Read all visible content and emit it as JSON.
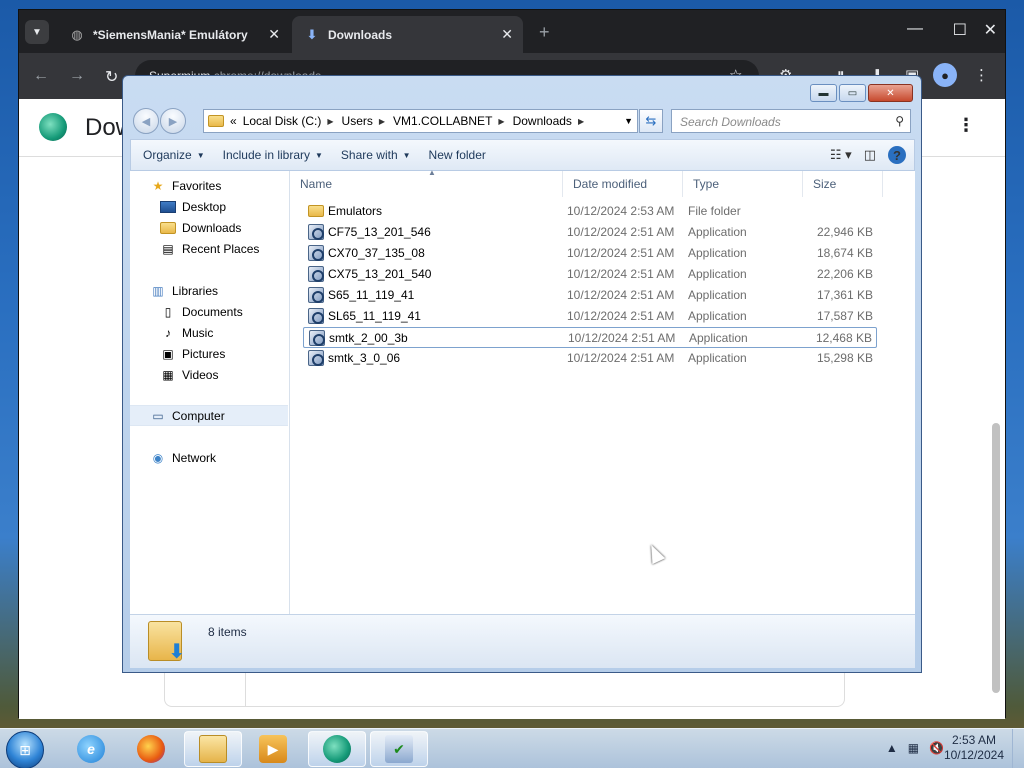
{
  "browser": {
    "tabs": [
      {
        "title": "*SiemensMania* Emulátory",
        "icon": "globe-icon"
      },
      {
        "title": "Downloads",
        "icon": "download-icon"
      }
    ],
    "omnibox": {
      "hostname": "Supermium",
      "path": "chrome://downloads"
    },
    "page_title": "Downloads"
  },
  "explorer": {
    "breadcrumb": [
      "Local Disk (C:)",
      "Users",
      "VM1.COLLABNET",
      "Downloads"
    ],
    "search_placeholder": "Search Downloads",
    "commands": {
      "organize": "Organize",
      "include": "Include in library",
      "share": "Share with",
      "new_folder": "New folder"
    },
    "nav": {
      "favorites": "Favorites",
      "desktop": "Desktop",
      "downloads": "Downloads",
      "recent": "Recent Places",
      "libraries": "Libraries",
      "documents": "Documents",
      "music": "Music",
      "pictures": "Pictures",
      "videos": "Videos",
      "computer": "Computer",
      "network": "Network"
    },
    "columns": {
      "name": "Name",
      "date": "Date modified",
      "type": "Type",
      "size": "Size"
    },
    "files": [
      {
        "name": "Emulators",
        "date": "10/12/2024 2:53 AM",
        "type": "File folder",
        "size": "",
        "icon": "folder-icon"
      },
      {
        "name": "CF75_13_201_546",
        "date": "10/12/2024 2:51 AM",
        "type": "Application",
        "size": "22,946 KB",
        "icon": "application-icon"
      },
      {
        "name": "CX70_37_135_08",
        "date": "10/12/2024 2:51 AM",
        "type": "Application",
        "size": "18,674 KB",
        "icon": "application-icon"
      },
      {
        "name": "CX75_13_201_540",
        "date": "10/12/2024 2:51 AM",
        "type": "Application",
        "size": "22,206 KB",
        "icon": "application-icon"
      },
      {
        "name": "S65_11_119_41",
        "date": "10/12/2024 2:51 AM",
        "type": "Application",
        "size": "17,361 KB",
        "icon": "application-icon"
      },
      {
        "name": "SL65_11_119_41",
        "date": "10/12/2024 2:51 AM",
        "type": "Application",
        "size": "17,587 KB",
        "icon": "application-icon"
      },
      {
        "name": "smtk_2_00_3b",
        "date": "10/12/2024 2:51 AM",
        "type": "Application",
        "size": "12,468 KB",
        "icon": "application-icon"
      },
      {
        "name": "smtk_3_0_06",
        "date": "10/12/2024 2:51 AM",
        "type": "Application",
        "size": "15,298 KB",
        "icon": "application-icon"
      }
    ],
    "item_count": "8 items"
  },
  "taskbar": {
    "time": "2:53 AM",
    "date": "10/12/2024"
  }
}
